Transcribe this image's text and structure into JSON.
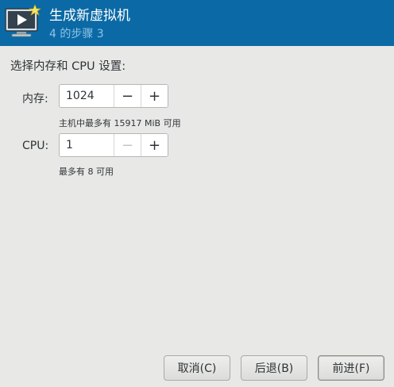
{
  "header": {
    "title": "生成新虚拟机",
    "subtitle": "4 的步骤 3",
    "icon": "new-vm-monitor-icon"
  },
  "section_heading": "选择内存和 CPU 设置:",
  "memory": {
    "label": "内存:",
    "value": "1024",
    "hint": "主机中最多有 15917 MiB 可用",
    "decrement": "−",
    "increment": "+"
  },
  "cpu": {
    "label": "CPU:",
    "value": "1",
    "hint": "最多有 8 可用",
    "decrement": "−",
    "increment": "+"
  },
  "buttons": {
    "cancel": "取消(C)",
    "back": "后退(B)",
    "forward": "前进(F)"
  },
  "colors": {
    "header_bg": "#0b6aa5",
    "header_subtitle": "#8fc3e6",
    "window_bg": "#e8e8e7"
  }
}
